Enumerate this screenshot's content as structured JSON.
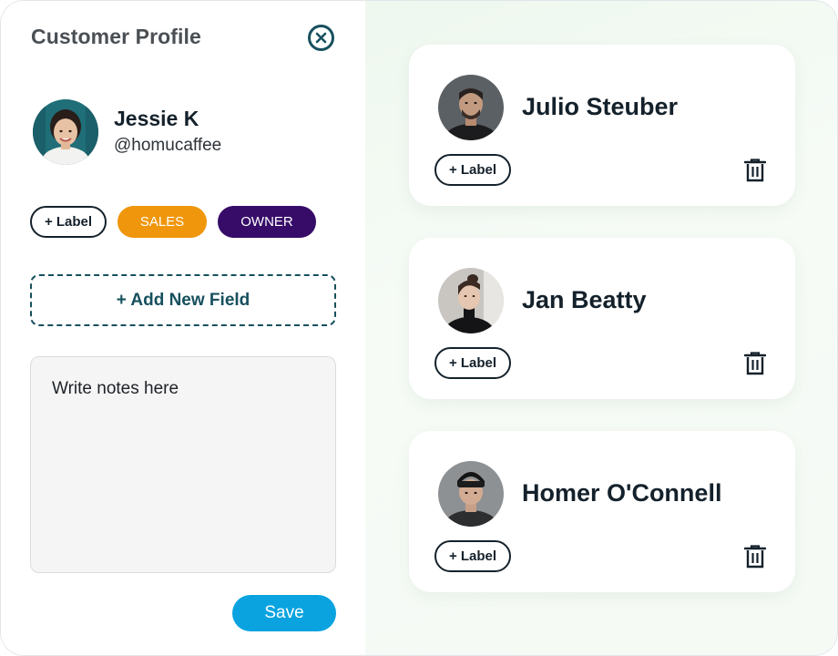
{
  "panel": {
    "title": "Customer Profile",
    "close_icon": "close-circle-icon"
  },
  "profile": {
    "name": "Jessie K",
    "handle": "@homucaffee"
  },
  "tags": {
    "add_label": "+ Label",
    "items": [
      {
        "label": "SALES",
        "color": "#f0960c"
      },
      {
        "label": "OWNER",
        "color": "#360c68"
      }
    ]
  },
  "add_field": {
    "label": "+ Add New Field"
  },
  "notes": {
    "placeholder": "Write notes here",
    "value": ""
  },
  "save": {
    "label": "Save"
  },
  "contacts": [
    {
      "name": "Julio Steuber",
      "add_label": "+ Label",
      "delete_icon": "trash-icon"
    },
    {
      "name": "Jan Beatty",
      "add_label": "+ Label",
      "delete_icon": "trash-icon"
    },
    {
      "name": "Homer O'Connell",
      "add_label": "+ Label",
      "delete_icon": "trash-icon"
    }
  ],
  "colors": {
    "accent_teal": "#17505e",
    "save_blue": "#0aa3e0",
    "panel_bg_right": "#eef8ef"
  }
}
